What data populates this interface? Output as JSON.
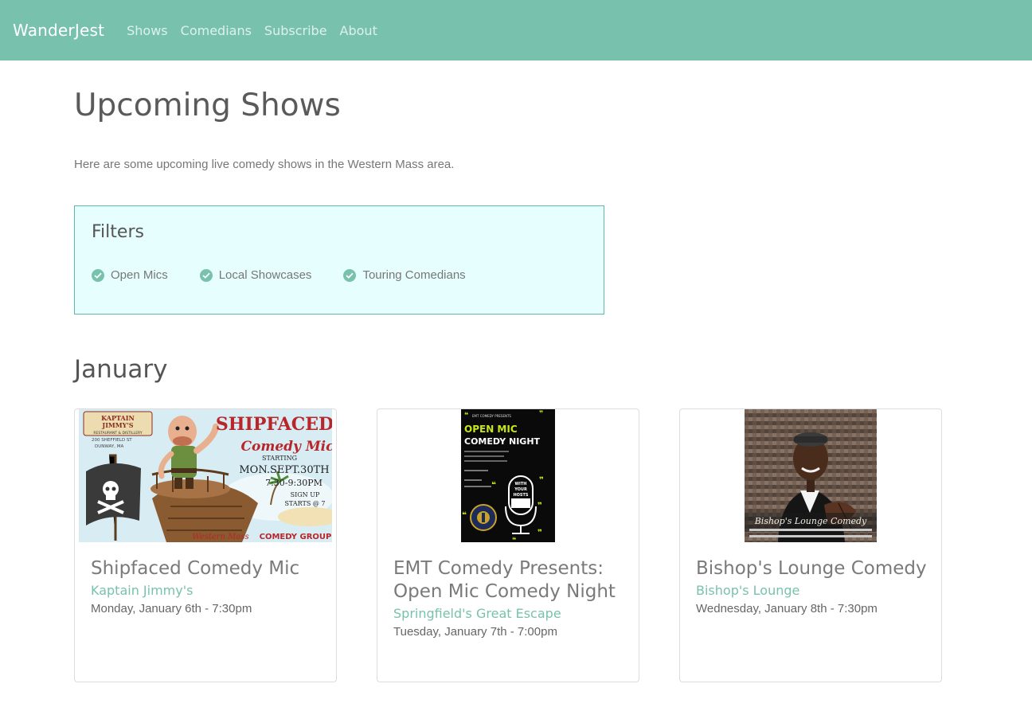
{
  "navbar": {
    "brand": "WanderJest",
    "links": [
      "Shows",
      "Comedians",
      "Subscribe",
      "About"
    ]
  },
  "page": {
    "title": "Upcoming Shows",
    "lead": "Here are some upcoming live comedy shows in the Western Mass area."
  },
  "filters": {
    "title": "Filters",
    "items": [
      {
        "label": "Open Mics",
        "checked": true
      },
      {
        "label": "Local Showcases",
        "checked": true
      },
      {
        "label": "Touring Comedians",
        "checked": true
      }
    ]
  },
  "month": "January",
  "shows": [
    {
      "title": "Shipfaced Comedy Mic",
      "venue": "Kaptain Jimmy's",
      "date": "Monday, January 6th - 7:30pm",
      "poster": {
        "logo_line1": "KAPTAIN",
        "logo_line2": "JIMMY'S",
        "logo_sub": "RESTAURANT & DISTILLERY",
        "address_line1": "200 SHEFFIELD ST",
        "address_line2": "DUNWAY, MA",
        "headline1": "SHIPFACED",
        "headline2": "Comedy Mic",
        "starting": "STARTING",
        "start_date": "MON.SEPT.30TH",
        "time": "7:30-9:30PM",
        "signup1": "SIGN UP",
        "signup2": "STARTS @ 7",
        "footer1": "Western Mass",
        "footer2": "COMEDY GROUP"
      }
    },
    {
      "title": "EMT Comedy Presents: Open Mic Comedy Night",
      "venue": "Springfield's Great Escape",
      "date": "Tuesday, January 7th - 7:00pm",
      "poster": {
        "presents": "EMT COMEDY PRESENTS",
        "headline1": "OPEN MIC",
        "headline2": "COMEDY NIGHT",
        "host1": "WITH",
        "host2": "YOUR",
        "host3": "HOSTS"
      }
    },
    {
      "title": "Bishop's Lounge Comedy",
      "venue": "Bishop's Lounge",
      "date": "Wednesday, January 8th - 7:30pm",
      "poster": {
        "script": "Bishop's Lounge Comedy"
      }
    }
  ],
  "colors": {
    "primary": "#78c2ad",
    "filters_bg": "#e6fffe",
    "filters_border": "#5fb8ad"
  }
}
